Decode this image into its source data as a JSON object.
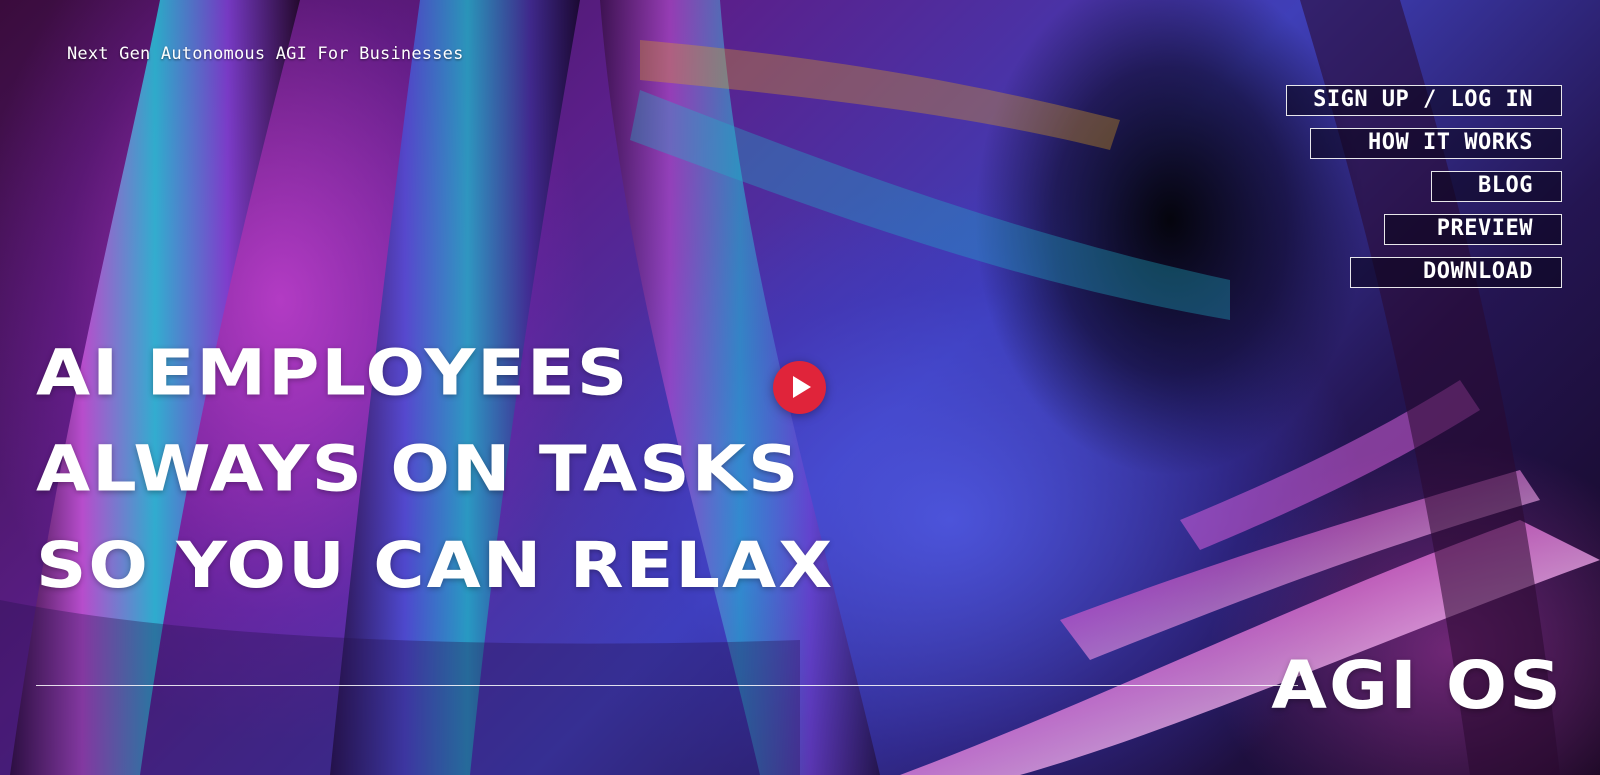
{
  "tagline": "Next Gen Autonomous AGI For Businesses",
  "nav": {
    "items": [
      {
        "label": "SIGN UP / LOG IN"
      },
      {
        "label": "HOW IT WORKS"
      },
      {
        "label": "BLOG"
      },
      {
        "label": "PREVIEW"
      },
      {
        "label": "DOWNLOAD"
      }
    ]
  },
  "hero": {
    "line1": "AI EMPLOYEES",
    "line2": "ALWAYS ON TASKS",
    "line3": "SO YOU CAN RELAX"
  },
  "video": {
    "icon": "play-icon"
  },
  "brand": "AGI OS",
  "colors": {
    "play_button": "#e0243a",
    "text": "#ffffff"
  }
}
